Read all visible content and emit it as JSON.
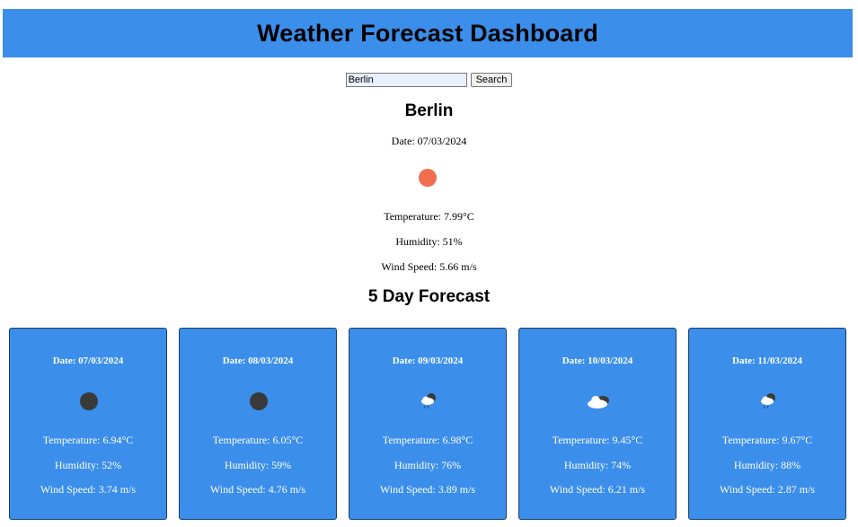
{
  "header": {
    "title": "Weather Forecast Dashboard"
  },
  "search": {
    "value": "Berlin",
    "button_label": "Search"
  },
  "current": {
    "city": "Berlin",
    "date": "Date: 07/03/2024",
    "icon": "sun-icon",
    "temperature": "Temperature: 7.99°C",
    "humidity": "Humidity: 51%",
    "wind": "Wind Speed: 5.66 m/s"
  },
  "forecast_title": "5 Day Forecast",
  "forecast": [
    {
      "date": "Date: 07/03/2024",
      "icon": "clear-night-icon",
      "temperature": "Temperature: 6.94°C",
      "humidity": "Humidity: 52%",
      "wind": "Wind Speed: 3.74 m/s"
    },
    {
      "date": "Date: 08/03/2024",
      "icon": "clear-night-icon",
      "temperature": "Temperature: 6.05°C",
      "humidity": "Humidity: 59%",
      "wind": "Wind Speed: 4.76 m/s"
    },
    {
      "date": "Date: 09/03/2024",
      "icon": "rain-cloud-icon",
      "temperature": "Temperature: 6.98°C",
      "humidity": "Humidity: 76%",
      "wind": "Wind Speed: 3.89 m/s"
    },
    {
      "date": "Date: 10/03/2024",
      "icon": "cloud-icon",
      "temperature": "Temperature: 9.45°C",
      "humidity": "Humidity: 74%",
      "wind": "Wind Speed: 6.21 m/s"
    },
    {
      "date": "Date: 11/03/2024",
      "icon": "rain-cloud-icon",
      "temperature": "Temperature: 9.67°C",
      "humidity": "Humidity: 88%",
      "wind": "Wind Speed: 2.87 m/s"
    }
  ],
  "colors": {
    "header_bg": "#3b8eea",
    "card_bg": "#3b8eea",
    "sun": "#ee6e4f"
  }
}
